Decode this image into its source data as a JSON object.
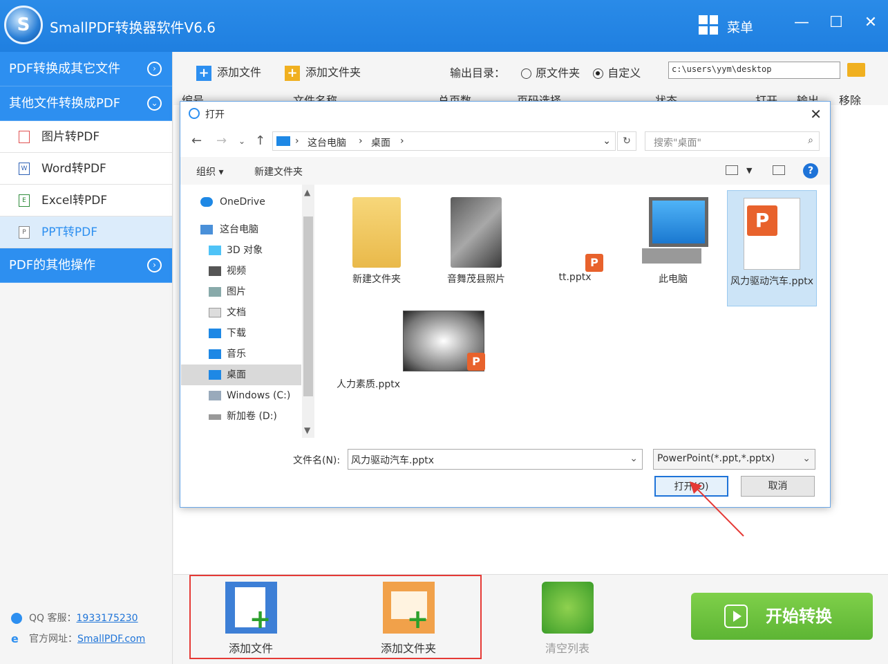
{
  "app": {
    "title": "SmallPDF转换器软件V6.6",
    "menu_label": "菜单"
  },
  "sidebar": {
    "cat1": "PDF转换成其它文件",
    "cat2": "其他文件转换成PDF",
    "items": [
      {
        "label": "图片转PDF"
      },
      {
        "label": "Word转PDF"
      },
      {
        "label": "Excel转PDF"
      },
      {
        "label": "PPT转PDF"
      }
    ],
    "cat3": "PDF的其他操作",
    "qq_label": "QQ 客服：",
    "qq_value": "1933175230",
    "site_label": "官方网址：",
    "site_value": "SmallPDF.com"
  },
  "toolbar": {
    "add_file": "添加文件",
    "add_folder": "添加文件夹",
    "output_label": "输出目录：",
    "radio_original": "原文件夹",
    "radio_custom": "自定义",
    "output_path": "c:\\users\\yym\\desktop"
  },
  "list_header": [
    "编号",
    "文件名称",
    "总页数",
    "页码选择",
    "状态",
    "打开",
    "输出",
    "移除"
  ],
  "bottom": {
    "add_file": "添加文件",
    "add_folder": "添加文件夹",
    "clear_list": "清空列表",
    "start": "开始转换"
  },
  "dialog": {
    "title": "打开",
    "breadcrumb": [
      "这台电脑",
      "桌面"
    ],
    "search_placeholder": "搜索\"桌面\"",
    "organize": "组织 ▾",
    "new_folder": "新建文件夹",
    "tree": [
      {
        "label": "OneDrive"
      },
      {
        "label": "这台电脑"
      },
      {
        "label": "3D 对象"
      },
      {
        "label": "视频"
      },
      {
        "label": "图片"
      },
      {
        "label": "文档"
      },
      {
        "label": "下载"
      },
      {
        "label": "音乐"
      },
      {
        "label": "桌面"
      },
      {
        "label": "Windows (C:)"
      },
      {
        "label": "新加卷 (D:)"
      }
    ],
    "files": [
      {
        "name": "新建文件夹"
      },
      {
        "name": "音舞茂县照片"
      },
      {
        "name": "tt.pptx"
      },
      {
        "name": "此电脑"
      },
      {
        "name": "风力驱动汽车.pptx"
      },
      {
        "name": "人力素质.pptx"
      }
    ],
    "filename_label": "文件名(N):",
    "filename_value": "风力驱动汽车.pptx",
    "filetype": "PowerPoint(*.ppt,*.pptx)",
    "open_btn": "打开(O)",
    "cancel_btn": "取消"
  },
  "colors": {
    "brand": "#2d8ff0",
    "start": "#6cc23d",
    "highlight": "#e53935"
  }
}
